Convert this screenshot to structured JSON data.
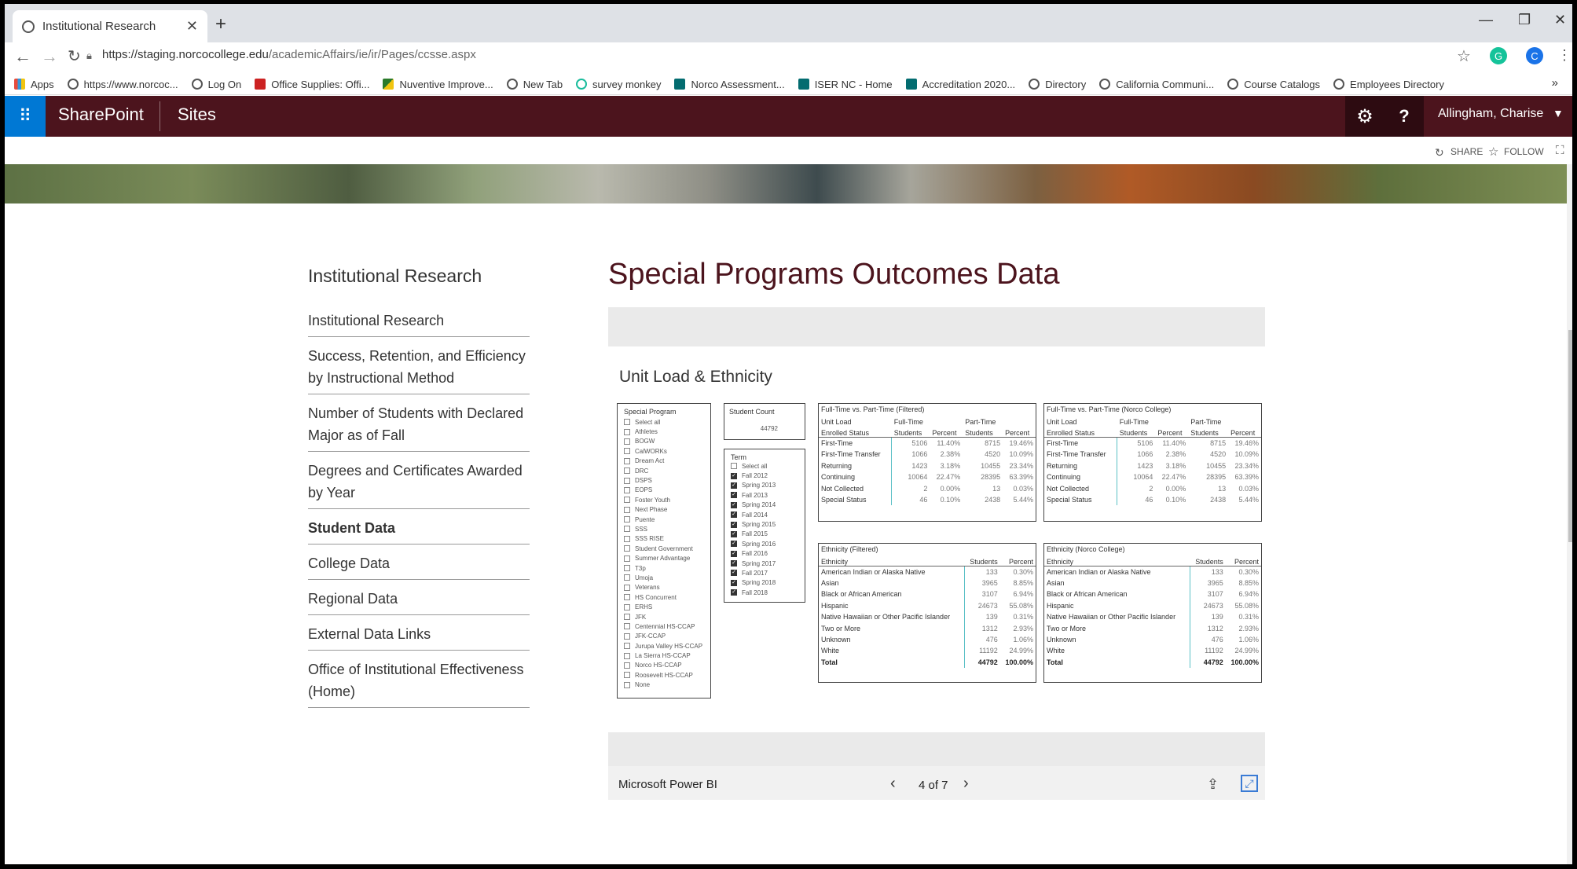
{
  "browser": {
    "tab_title": "Institutional Research",
    "url_host": "https://staging.norcocollege.edu",
    "url_path": "/academicAffairs/ie/ir/Pages/ccsse.aspx",
    "profile_initial": "C",
    "bookmarks": [
      "Apps",
      "https://www.norcoc...",
      "Log On",
      "Office Supplies: Offi...",
      "Nuventive Improve...",
      "New Tab",
      "survey monkey",
      "Norco Assessment...",
      "ISER NC - Home",
      "Accreditation 2020...",
      "Directory",
      "California Communi...",
      "Course Catalogs",
      "Employees Directory"
    ]
  },
  "sharepoint": {
    "brand": "SharePoint",
    "sites": "Sites",
    "user": "Allingham, Charise",
    "share": "SHARE",
    "follow": "FOLLOW"
  },
  "nav": {
    "title": "Institutional Research",
    "items": [
      {
        "label": "Institutional Research"
      },
      {
        "label": "Success, Retention, and Efficiency by Instructional Method"
      },
      {
        "label": "Number of Students with Declared Major as of Fall"
      },
      {
        "label": "Degrees and Certificates Awarded by Year"
      },
      {
        "label": "Student Data"
      },
      {
        "label": "College Data"
      },
      {
        "label": "Regional Data"
      },
      {
        "label": "External Data Links"
      },
      {
        "label": "Office of Institutional Effectiveness (Home)"
      }
    ]
  },
  "main": {
    "title": "Special Programs Outcomes Data"
  },
  "report": {
    "title": "Unit Load & Ethnicity",
    "special_program": {
      "title": "Special Program",
      "options": [
        {
          "label": "Select all",
          "checked": false
        },
        {
          "label": "Athletes",
          "checked": false
        },
        {
          "label": "BOGW",
          "checked": false
        },
        {
          "label": "CalWORKs",
          "checked": false
        },
        {
          "label": "Dream Act",
          "checked": false
        },
        {
          "label": "DRC",
          "checked": false
        },
        {
          "label": "DSPS",
          "checked": false
        },
        {
          "label": "EOPS",
          "checked": false
        },
        {
          "label": "Foster Youth",
          "checked": false
        },
        {
          "label": "Next Phase",
          "checked": false
        },
        {
          "label": "Puente",
          "checked": false
        },
        {
          "label": "SSS",
          "checked": false
        },
        {
          "label": "SSS RISE",
          "checked": false
        },
        {
          "label": "Student Government",
          "checked": false
        },
        {
          "label": "Summer Advantage",
          "checked": false
        },
        {
          "label": "T3p",
          "checked": false
        },
        {
          "label": "Umoja",
          "checked": false
        },
        {
          "label": "Veterans",
          "checked": false
        },
        {
          "label": "HS Concurrent",
          "checked": false
        },
        {
          "label": "ERHS",
          "checked": false
        },
        {
          "label": "JFK",
          "checked": false
        },
        {
          "label": "Centennial HS-CCAP",
          "checked": false
        },
        {
          "label": "JFK-CCAP",
          "checked": false
        },
        {
          "label": "Jurupa Valley HS-CCAP",
          "checked": false
        },
        {
          "label": "La Sierra HS-CCAP",
          "checked": false
        },
        {
          "label": "Norco HS-CCAP",
          "checked": false
        },
        {
          "label": "Roosevelt HS-CCAP",
          "checked": false
        },
        {
          "label": "None",
          "checked": false
        }
      ]
    },
    "student_count": {
      "title": "Student Count",
      "value": "44792"
    },
    "term": {
      "title": "Term",
      "options": [
        {
          "label": "Select all",
          "checked": false
        },
        {
          "label": "Fall 2012",
          "checked": true
        },
        {
          "label": "Spring 2013",
          "checked": true
        },
        {
          "label": "Fall 2013",
          "checked": true
        },
        {
          "label": "Spring 2014",
          "checked": true
        },
        {
          "label": "Fall 2014",
          "checked": true
        },
        {
          "label": "Spring 2015",
          "checked": true
        },
        {
          "label": "Fall 2015",
          "checked": true
        },
        {
          "label": "Spring 2016",
          "checked": true
        },
        {
          "label": "Fall 2016",
          "checked": true
        },
        {
          "label": "Spring 2017",
          "checked": true
        },
        {
          "label": "Fall 2017",
          "checked": true
        },
        {
          "label": "Spring 2018",
          "checked": true
        },
        {
          "label": "Fall 2018",
          "checked": true
        }
      ]
    },
    "unit_load_tables": [
      {
        "title": "Full-Time vs. Part-Time (Filtered)",
        "h1": [
          "Unit Load",
          "Full-Time",
          "",
          "Part-Time",
          ""
        ],
        "h2": [
          "Enrolled Status",
          "Students",
          "Percent",
          "Students",
          "Percent"
        ],
        "rows": [
          [
            "First-Time",
            "5106",
            "11.40%",
            "8715",
            "19.46%"
          ],
          [
            "First-Time Transfer",
            "1066",
            "2.38%",
            "4520",
            "10.09%"
          ],
          [
            "Returning",
            "1423",
            "3.18%",
            "10455",
            "23.34%"
          ],
          [
            "Continuing",
            "10064",
            "22.47%",
            "28395",
            "63.39%"
          ],
          [
            "Not Collected",
            "2",
            "0.00%",
            "13",
            "0.03%"
          ],
          [
            "Special Status",
            "46",
            "0.10%",
            "2438",
            "5.44%"
          ]
        ]
      },
      {
        "title": "Full-Time vs. Part-Time (Norco College)",
        "h1": [
          "Unit Load",
          "Full-Time",
          "",
          "Part-Time",
          ""
        ],
        "h2": [
          "Enrolled Status",
          "Students",
          "Percent",
          "Students",
          "Percent"
        ],
        "rows": [
          [
            "First-Time",
            "5106",
            "11.40%",
            "8715",
            "19.46%"
          ],
          [
            "First-Time Transfer",
            "1066",
            "2.38%",
            "4520",
            "10.09%"
          ],
          [
            "Returning",
            "1423",
            "3.18%",
            "10455",
            "23.34%"
          ],
          [
            "Continuing",
            "10064",
            "22.47%",
            "28395",
            "63.39%"
          ],
          [
            "Not Collected",
            "2",
            "0.00%",
            "13",
            "0.03%"
          ],
          [
            "Special Status",
            "46",
            "0.10%",
            "2438",
            "5.44%"
          ]
        ]
      }
    ],
    "ethnicity_tables": [
      {
        "title": "Ethnicity (Filtered)",
        "header": [
          "Ethnicity",
          "Students",
          "Percent"
        ],
        "rows": [
          [
            "American Indian or Alaska Native",
            "133",
            "0.30%"
          ],
          [
            "Asian",
            "3965",
            "8.85%"
          ],
          [
            "Black or African American",
            "3107",
            "6.94%"
          ],
          [
            "Hispanic",
            "24673",
            "55.08%"
          ],
          [
            "Native Hawaiian or Other Pacific Islander",
            "139",
            "0.31%"
          ],
          [
            "Two or More",
            "1312",
            "2.93%"
          ],
          [
            "Unknown",
            "476",
            "1.06%"
          ],
          [
            "White",
            "11192",
            "24.99%"
          ]
        ],
        "total": [
          "Total",
          "44792",
          "100.00%"
        ]
      },
      {
        "title": "Ethnicity (Norco College)",
        "header": [
          "Ethnicity",
          "Students",
          "Percent"
        ],
        "rows": [
          [
            "American Indian or Alaska Native",
            "133",
            "0.30%"
          ],
          [
            "Asian",
            "3965",
            "8.85%"
          ],
          [
            "Black or African American",
            "3107",
            "6.94%"
          ],
          [
            "Hispanic",
            "24673",
            "55.08%"
          ],
          [
            "Native Hawaiian or Other Pacific Islander",
            "139",
            "0.31%"
          ],
          [
            "Two or More",
            "1312",
            "2.93%"
          ],
          [
            "Unknown",
            "476",
            "1.06%"
          ],
          [
            "White",
            "11192",
            "24.99%"
          ]
        ],
        "total": [
          "Total",
          "44792",
          "100.00%"
        ]
      }
    ],
    "footer": {
      "brand": "Microsoft Power BI",
      "page": "4 of 7"
    }
  },
  "colors": {
    "suite_bar": "#4c141d",
    "accent": "#0078d4",
    "title": "#4c141d"
  }
}
